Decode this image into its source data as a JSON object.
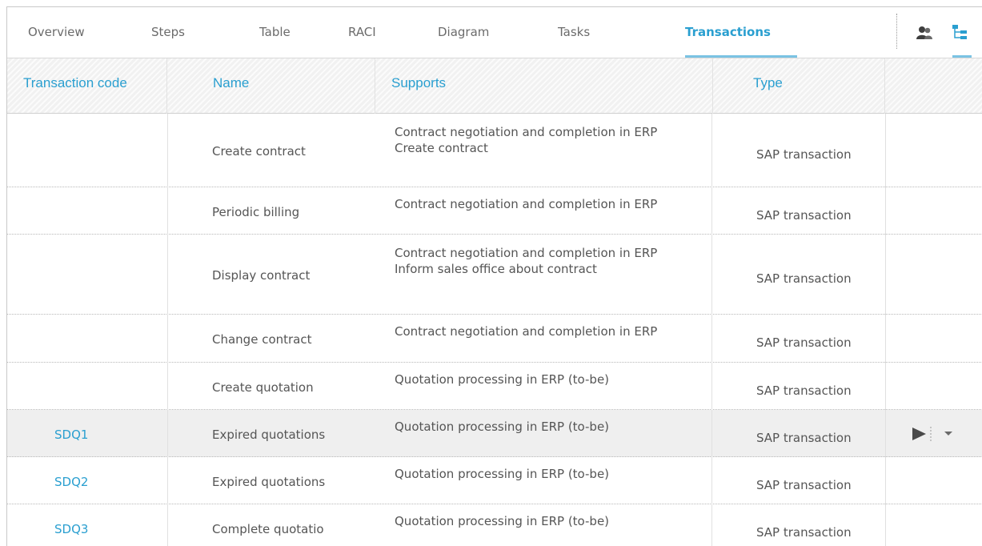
{
  "tabs": [
    {
      "label": "Overview",
      "active": false
    },
    {
      "label": "Steps",
      "active": false
    },
    {
      "label": "Table",
      "active": false
    },
    {
      "label": "RACI",
      "active": false
    },
    {
      "label": "Diagram",
      "active": false
    },
    {
      "label": "Tasks",
      "active": false
    },
    {
      "label": "Transactions",
      "active": true
    }
  ],
  "toolbar": {
    "icons": [
      "people-icon",
      "hierarchy-icon"
    ]
  },
  "colors": {
    "accent": "#2a9fd0",
    "underline": "#7ac3e3",
    "text": "#6b6b6b",
    "highlight_row": "#efefef"
  },
  "table": {
    "columns": [
      "Transaction code",
      "Name",
      "Supports",
      "Type"
    ],
    "rows": [
      {
        "code": "",
        "name": "Create contract",
        "supports": [
          "Contract negotiation and completion in ERP",
          "Create contract"
        ],
        "type": "SAP transaction"
      },
      {
        "code": "",
        "name": "Periodic billing",
        "supports": [
          "Contract negotiation and completion in ERP"
        ],
        "type": "SAP transaction"
      },
      {
        "code": "",
        "name": "Display contract",
        "supports": [
          "Contract negotiation and completion in ERP",
          "Inform sales office about contract"
        ],
        "type": "SAP transaction"
      },
      {
        "code": "",
        "name": "Change contract",
        "supports": [
          "Contract negotiation and completion in ERP"
        ],
        "type": "SAP transaction"
      },
      {
        "code": "",
        "name": "Create quotation",
        "supports": [
          "Quotation processing in ERP (to-be)"
        ],
        "type": "SAP transaction"
      },
      {
        "code": "SDQ1",
        "name": "Expired quotations",
        "supports": [
          "Quotation processing in ERP (to-be)"
        ],
        "type": "SAP transaction",
        "highlighted": true,
        "actions": [
          "play-icon",
          "dropdown-arrow-icon"
        ]
      },
      {
        "code": "SDQ2",
        "name": "Expired quotations",
        "supports": [
          "Quotation processing in ERP (to-be)"
        ],
        "type": "SAP transaction"
      },
      {
        "code": "SDQ3",
        "name": "Complete quotatio",
        "supports": [
          "Quotation processing in ERP (to-be)"
        ],
        "type": "SAP transaction"
      }
    ]
  }
}
